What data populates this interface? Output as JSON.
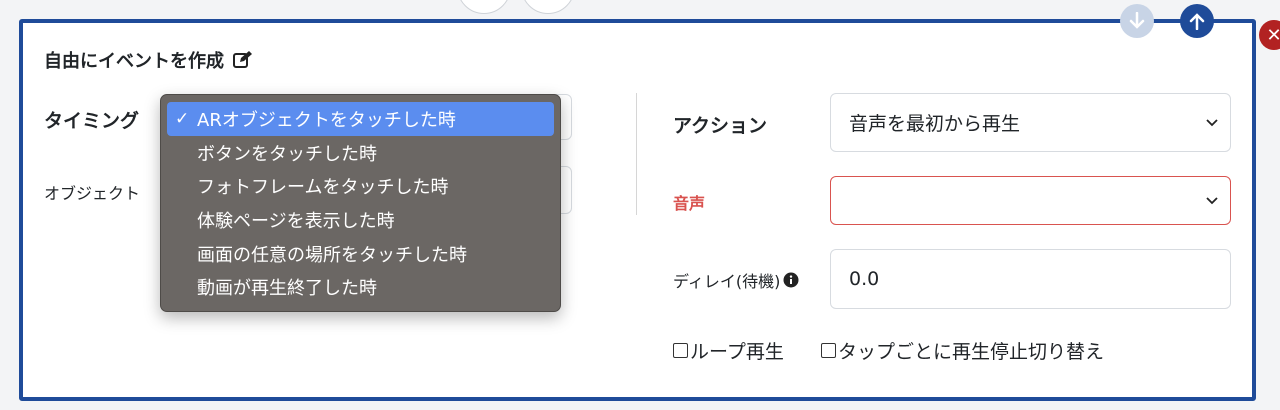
{
  "title": "自由にイベントを作成",
  "timing": {
    "label": "タイミング",
    "options": [
      "ARオブジェクトをタッチした時",
      "ボタンをタッチした時",
      "フォトフレームをタッチした時",
      "体験ページを表示した時",
      "画面の任意の場所をタッチした時",
      "動画が再生終了した時"
    ],
    "selected_index": 0
  },
  "object": {
    "label": "オブジェクト"
  },
  "action": {
    "label": "アクション",
    "value": "音声を最初から再生"
  },
  "audio": {
    "label": "音声",
    "value": ""
  },
  "delay": {
    "label": "ディレイ(待機)",
    "value": "0.0"
  },
  "loop": {
    "label": "ループ再生",
    "checked": false
  },
  "tap_toggle": {
    "label": "タップごとに再生停止切り替え",
    "checked": false
  },
  "colors": {
    "panel_border": "#1f4b99",
    "selected": "#5b8def",
    "error": "#d9534f"
  },
  "icons": [
    "edit-icon",
    "info-icon",
    "chevron-down-icon",
    "arrow-up-icon",
    "arrow-down-icon",
    "close-icon",
    "checkmark-icon"
  ]
}
